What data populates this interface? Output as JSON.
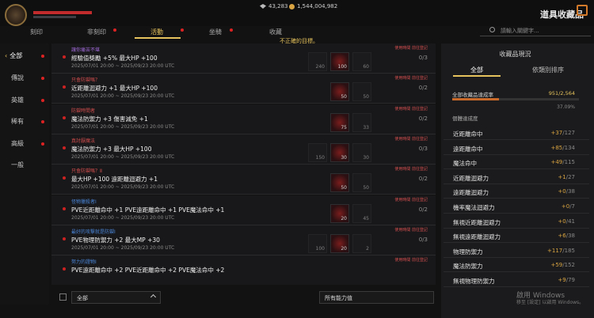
{
  "header": {
    "currency_gems": "43,283",
    "currency_gold": "1,544,004,982",
    "page_title": "道具收藏品"
  },
  "tabs": [
    "刻印",
    "非刻印",
    "活動",
    "坐騎",
    "收藏"
  ],
  "search_placeholder": "請輸入關鍵字...",
  "warning": "不正確的目標。",
  "sidebar": [
    "全部",
    "傳說",
    "英雄",
    "稀有",
    "高級",
    "一般"
  ],
  "rows": [
    {
      "tag": "讓你痛苦不堪",
      "tag_color": "#a06ad8",
      "title": "經驗值獎勵 +5% 最大HP +100",
      "date": "2025/07/01 20:00 ~ 2025/09/23 20:00 UTC",
      "status": "使用時間 前往登記",
      "slots": [
        "240",
        "100",
        "60"
      ],
      "count": "0/3"
    },
    {
      "tag": "只會防禦嗎？",
      "tag_color": "#d24d4d",
      "title": "近距離迴避力 +1 最大HP +100",
      "date": "2025/07/01 20:00 ~ 2025/09/23 20:00 UTC",
      "status": "使用時間 前往登記",
      "slots": [
        "50",
        "50"
      ],
      "count": "0/2"
    },
    {
      "tag": "防禦時間者",
      "tag_color": "#d24d4d",
      "title": "魔法防禦力 +3 傷害減免 +1",
      "date": "2025/07/01 20:00 ~ 2025/09/23 20:00 UTC",
      "status": "使用時間 前往登記",
      "slots": [
        "75",
        "33"
      ],
      "count": "0/2"
    },
    {
      "tag": "真討厭魔法",
      "tag_color": "#d24d4d",
      "title": "魔法防禦力 +3 最大HP +100",
      "date": "2025/07/01 20:00 ~ 2025/09/23 20:00 UTC",
      "status": "使用時間 前往登記",
      "slots": [
        "150",
        "30",
        "30"
      ],
      "count": "0/3"
    },
    {
      "tag": "只會防禦嗎？Ⅱ",
      "tag_color": "#d24d4d",
      "title": "最大HP +100 遠距離迴避力 +1",
      "date": "2025/07/01 20:00 ~ 2025/09/23 20:00 UTC",
      "status": "使用時間 前往登記",
      "slots": [
        "50",
        "50"
      ],
      "count": "0/2"
    },
    {
      "tag": "怪物獵殺者Ⅰ",
      "tag_color": "#4a86d8",
      "title": "PVE近距離命中 +1 PVE遠距離命中 +1 PVE魔法命中 +1",
      "date": "2025/07/01 20:00 ~ 2025/09/23 20:00 UTC",
      "status": "使用時間 前往登記",
      "slots": [
        "20",
        "45"
      ],
      "count": "0/2"
    },
    {
      "tag": "最好的攻擊就是防禦Ⅰ",
      "tag_color": "#4a86d8",
      "title": "PVE物理防禦力 +2 最大MP +30",
      "date": "2025/07/01 20:00 ~ 2025/09/23 20:00 UTC",
      "status": "使用時間 前往登記",
      "slots": [
        "100",
        "20",
        "2"
      ],
      "count": "0/3"
    },
    {
      "tag": "努力的證物Ⅰ",
      "tag_color": "#4a86d8",
      "title": "PVE遠距離命中 +2 PVE近距離命中 +2 PVE魔法命中 +2",
      "date": "",
      "status": "使用時間 前往登記",
      "slots": [],
      "count": ""
    }
  ],
  "bottom": {
    "dropdown": "全部",
    "filter": "所有能力值"
  },
  "right": {
    "header": "收藏品現況",
    "tabs": [
      "全部",
      "依類別排序"
    ],
    "summary_label": "全部收藏品達成率",
    "summary_value": "951/2,564",
    "summary_progress": 0.3709,
    "summary_pct": "37.09%",
    "section": "個體達成度",
    "stats": [
      {
        "label": "近距離命中",
        "cur": "+37",
        "max": "/127"
      },
      {
        "label": "遠距離命中",
        "cur": "+85",
        "max": "/134"
      },
      {
        "label": "魔法命中",
        "cur": "+49",
        "max": "/115"
      },
      {
        "label": "近距離迴避力",
        "cur": "+1",
        "max": "/27"
      },
      {
        "label": "遠距離迴避力",
        "cur": "+0",
        "max": "/38"
      },
      {
        "label": "機率魔法迴避力",
        "cur": "+0",
        "max": "/7"
      },
      {
        "label": "無視近距離迴避力",
        "cur": "+0",
        "max": "/41"
      },
      {
        "label": "無視遠距離迴避力",
        "cur": "+6",
        "max": "/38"
      },
      {
        "label": "物理防禦力",
        "cur": "+117",
        "max": "/185"
      },
      {
        "label": "魔法防禦力",
        "cur": "+59",
        "max": "/152"
      },
      {
        "label": "無視物理防禦力",
        "cur": "+9",
        "max": "/79"
      }
    ]
  },
  "windows": {
    "title": "啟用 Windows",
    "sub": "移至 [設定] 以啟用 Windows。"
  }
}
